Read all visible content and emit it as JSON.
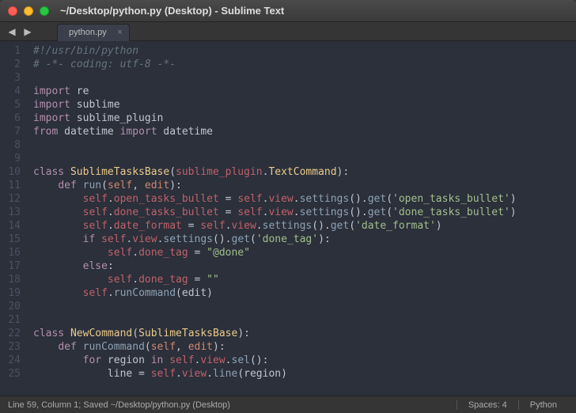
{
  "window": {
    "title": "~/Desktop/python.py (Desktop) - Sublime Text"
  },
  "tab": {
    "label": "python.py"
  },
  "gutter": {
    "start": 1,
    "end": 25
  },
  "code": {
    "l1_shebang": "#!/usr/bin/python",
    "l2_coding": "# -*- coding: utf-8 -*-",
    "kw_import": "import",
    "kw_from": "from",
    "kw_class": "class",
    "kw_def": "def",
    "kw_if": "if",
    "kw_else": "else",
    "kw_for": "for",
    "kw_in": "in",
    "mod_re": "re",
    "mod_sublime": "sublime",
    "mod_sublime_plugin": "sublime_plugin",
    "mod_datetime": "datetime",
    "cls_SublimeTasksBase": "SublimeTasksBase",
    "cls_NewCommand": "NewCommand",
    "base_TextCommand": "TextCommand",
    "fn_run": "run",
    "fn_runCommand": "runCommand",
    "id_self": "self",
    "id_edit": "edit",
    "id_region": "region",
    "id_line": "line",
    "attr_open_tasks_bullet": "open_tasks_bullet",
    "attr_done_tasks_bullet": "done_tasks_bullet",
    "attr_date_format": "date_format",
    "attr_done_tag": "done_tag",
    "attr_view": "view",
    "call_settings": "settings",
    "call_get": "get",
    "call_sel": "sel",
    "call_line": "line",
    "str_open_tasks_bullet": "'open_tasks_bullet'",
    "str_done_tasks_bullet": "'done_tasks_bullet'",
    "str_date_format": "'date_format'",
    "str_done_tag": "'done_tag'",
    "str_at_done": "\"@done\"",
    "str_empty": "\"\""
  },
  "status": {
    "left": "Line 59, Column 1; Saved ~/Desktop/python.py (Desktop)",
    "spaces": "Spaces: 4",
    "lang": "Python"
  }
}
